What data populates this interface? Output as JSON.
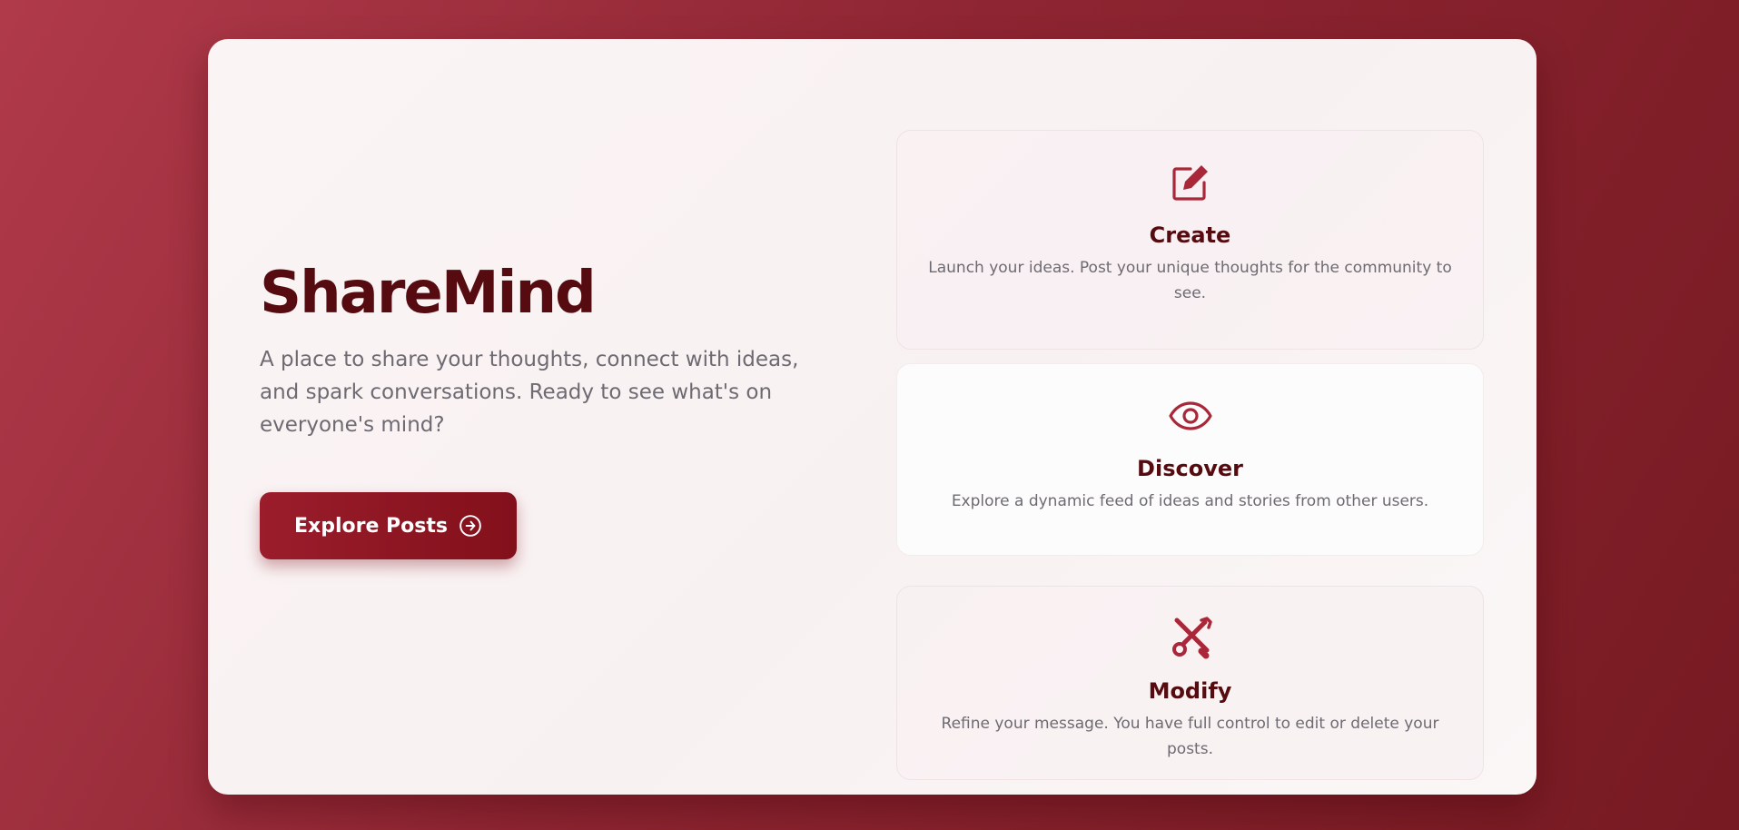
{
  "hero": {
    "title": "ShareMind",
    "tagline": "A place to share your thoughts, connect with ideas, and spark conversations. Ready to see what's on everyone's mind?",
    "cta_label": "Explore Posts",
    "cta_icon": "arrow-circle-right-icon"
  },
  "features": [
    {
      "icon": "edit-icon",
      "title": "Create",
      "description": "Launch your ideas. Post your unique thoughts for the community to see."
    },
    {
      "icon": "eye-icon",
      "title": "Discover",
      "description": "Explore a dynamic feed of ideas and stories from other users."
    },
    {
      "icon": "tools-icon",
      "title": "Modify",
      "description": "Refine your message. You have full control to edit or delete your posts."
    }
  ],
  "colors": {
    "accent": "#9b1d2c",
    "heading": "#550b10",
    "muted_text": "#6e6a72",
    "background": "#8e2532"
  }
}
